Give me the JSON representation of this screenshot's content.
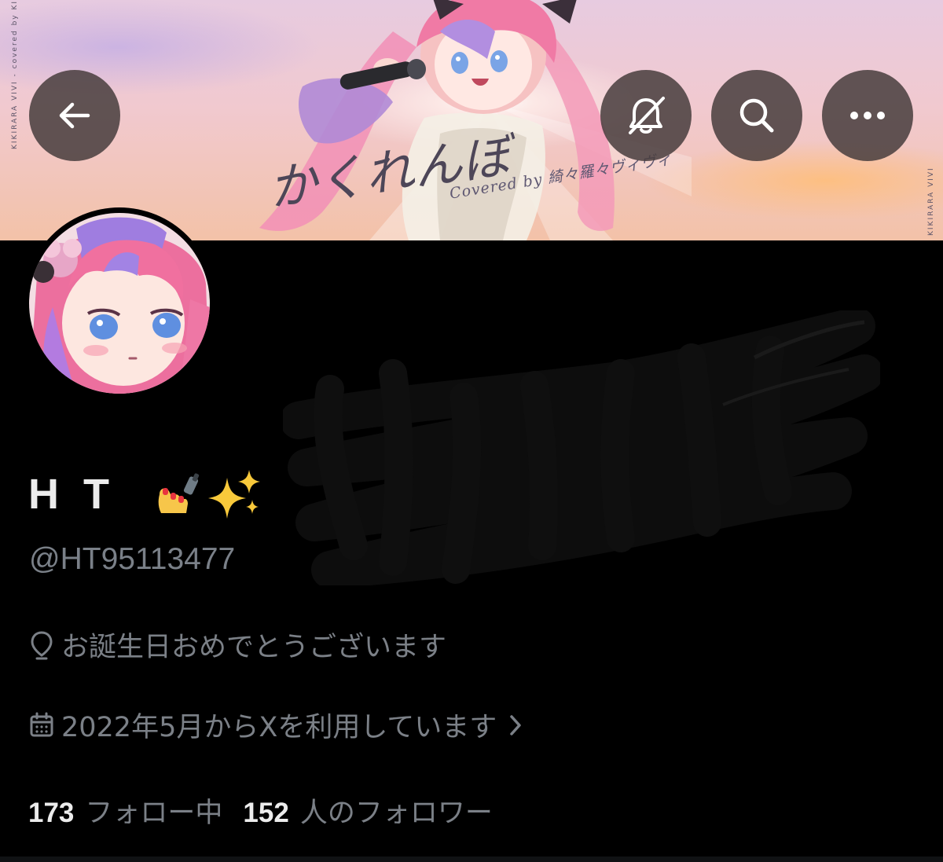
{
  "header": {
    "back_icon": "arrow-left-icon",
    "notifications_off_icon": "bell-slash-icon",
    "search_icon": "search-icon",
    "more_icon": "more-horizontal-icon"
  },
  "banner": {
    "title_text": "かくれんぼ",
    "credit_text": "Covered by 綺々羅々ヴィヴィ",
    "side_text_left": "KIKIRARA VIVI - covered by KIKIRARA VIVI",
    "side_text_right": "KIKIRARA VIVI"
  },
  "profile": {
    "display_name": "H T",
    "name_emojis": [
      "nail-polish-emoji",
      "sparkles-emoji"
    ],
    "handle": "@HT95113477",
    "location_icon": "location-pin-icon",
    "location": "お誕生日おめでとうございます",
    "joined_icon": "calendar-icon",
    "joined": "2022年5月からXを利用しています",
    "joined_chevron_icon": "chevron-right-icon",
    "following_count": "173",
    "following_label": "フォロー中",
    "followers_count": "152",
    "followers_label": "人のフォロワー"
  },
  "colors": {
    "background": "#000000",
    "primary_text": "#ececec",
    "secondary_text": "#7b8087",
    "button_bg": "#483e3e"
  }
}
